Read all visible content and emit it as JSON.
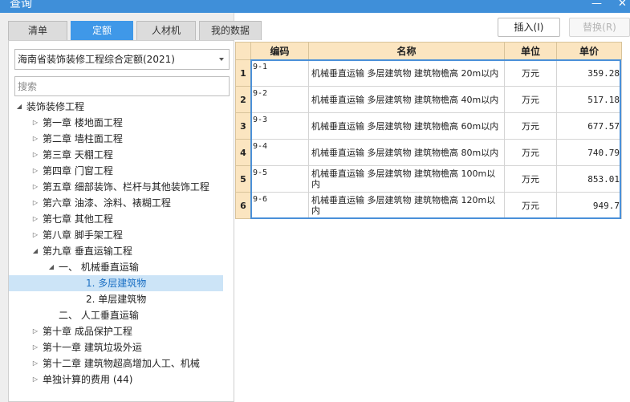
{
  "window": {
    "title": "查询",
    "close": "✕",
    "minimize": "—"
  },
  "tabs": [
    {
      "label": "清单",
      "active": false
    },
    {
      "label": "定额",
      "active": true
    },
    {
      "label": "人材机",
      "active": false
    },
    {
      "label": "我的数据",
      "active": false
    }
  ],
  "select": {
    "value": "海南省装饰装修工程综合定额(2021)"
  },
  "search": {
    "placeholder": "搜索"
  },
  "tree": [
    {
      "label": "装饰装修工程",
      "level": 0,
      "arrow": "◢"
    },
    {
      "label": "第一章 楼地面工程",
      "level": 1,
      "arrow": "▷"
    },
    {
      "label": "第二章 墙柱面工程",
      "level": 1,
      "arrow": "▷"
    },
    {
      "label": "第三章 天棚工程",
      "level": 1,
      "arrow": "▷"
    },
    {
      "label": "第四章 门窗工程",
      "level": 1,
      "arrow": "▷"
    },
    {
      "label": "第五章 细部装饰、栏杆与其他装饰工程",
      "level": 1,
      "arrow": "▷"
    },
    {
      "label": "第六章 油漆、涂料、裱糊工程",
      "level": 1,
      "arrow": "▷"
    },
    {
      "label": "第七章 其他工程",
      "level": 1,
      "arrow": "▷"
    },
    {
      "label": "第八章 脚手架工程",
      "level": 1,
      "arrow": "▷"
    },
    {
      "label": "第九章 垂直运输工程",
      "level": 1,
      "arrow": "◢"
    },
    {
      "label": "一、 机械垂直运输",
      "level": 2,
      "arrow": "◢"
    },
    {
      "label": "1. 多层建筑物",
      "level": 3,
      "arrow": "",
      "selected": true
    },
    {
      "label": "2. 单层建筑物",
      "level": 3,
      "arrow": ""
    },
    {
      "label": "二、 人工垂直运输",
      "level": 2,
      "arrow": ""
    },
    {
      "label": "第十章 成品保护工程",
      "level": 1,
      "arrow": "▷"
    },
    {
      "label": "第十一章 建筑垃圾外运",
      "level": 1,
      "arrow": "▷"
    },
    {
      "label": "第十二章 建筑物超高增加人工、机械",
      "level": 1,
      "arrow": "▷"
    },
    {
      "label": "单独计算的费用 (44)",
      "level": 1,
      "arrow": "▷"
    }
  ],
  "buttons": {
    "insert": "插入(I)",
    "replace": "替换(R)"
  },
  "grid": {
    "headers": [
      "编码",
      "名称",
      "单位",
      "单价"
    ],
    "rows": [
      {
        "no": "1",
        "code": "9-1",
        "name": "机械垂直运输 多层建筑物 建筑物檐高 20m以内",
        "unit": "万元",
        "price": "359.28"
      },
      {
        "no": "2",
        "code": "9-2",
        "name": "机械垂直运输 多层建筑物 建筑物檐高 40m以内",
        "unit": "万元",
        "price": "517.18"
      },
      {
        "no": "3",
        "code": "9-3",
        "name": "机械垂直运输 多层建筑物 建筑物檐高 60m以内",
        "unit": "万元",
        "price": "677.57"
      },
      {
        "no": "4",
        "code": "9-4",
        "name": "机械垂直运输 多层建筑物 建筑物檐高 80m以内",
        "unit": "万元",
        "price": "740.79"
      },
      {
        "no": "5",
        "code": "9-5",
        "name": "机械垂直运输 多层建筑物 建筑物檐高 100m以内",
        "unit": "万元",
        "price": "853.01"
      },
      {
        "no": "6",
        "code": "9-6",
        "name": "机械垂直运输 多层建筑物 建筑物檐高 120m以内",
        "unit": "万元",
        "price": "949.7"
      }
    ]
  },
  "colors": {
    "accent": "#3f98e8",
    "header_bg": "#fbe5c0",
    "selection": "#cce4f7"
  }
}
